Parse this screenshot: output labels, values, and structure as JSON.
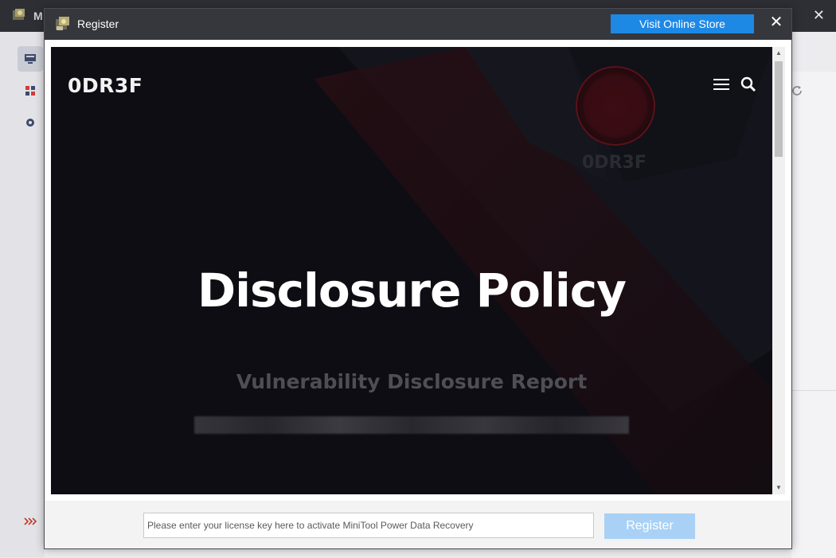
{
  "app": {
    "title": "M",
    "close_glyph": "✕"
  },
  "dialog": {
    "title": "Register",
    "store_button_label": "Visit Online Store",
    "close_glyph": "✕"
  },
  "webview": {
    "site_logo": "0DR3F",
    "emblem_text": "0DR3F",
    "hero_title": "Disclosure Policy",
    "hero_subtitle": "Vulnerability Disclosure Report"
  },
  "footer": {
    "license_placeholder": "Please enter your license key here to activate MiniTool Power Data Recovery",
    "license_value": "",
    "register_label": "Register"
  },
  "colors": {
    "accent": "#1e88e5",
    "register_disabled": "#a9d1f5",
    "titlebar": "#36373d",
    "webview_bg": "#0f0f14",
    "brand_red": "#8b1a22"
  },
  "icons": [
    "app-logo-icon",
    "monitor-icon",
    "apps-icon",
    "gear-icon",
    "refresh-icon",
    "chevrons-right-icon",
    "register-key-icon",
    "close-icon",
    "menu-icon",
    "search-icon"
  ]
}
